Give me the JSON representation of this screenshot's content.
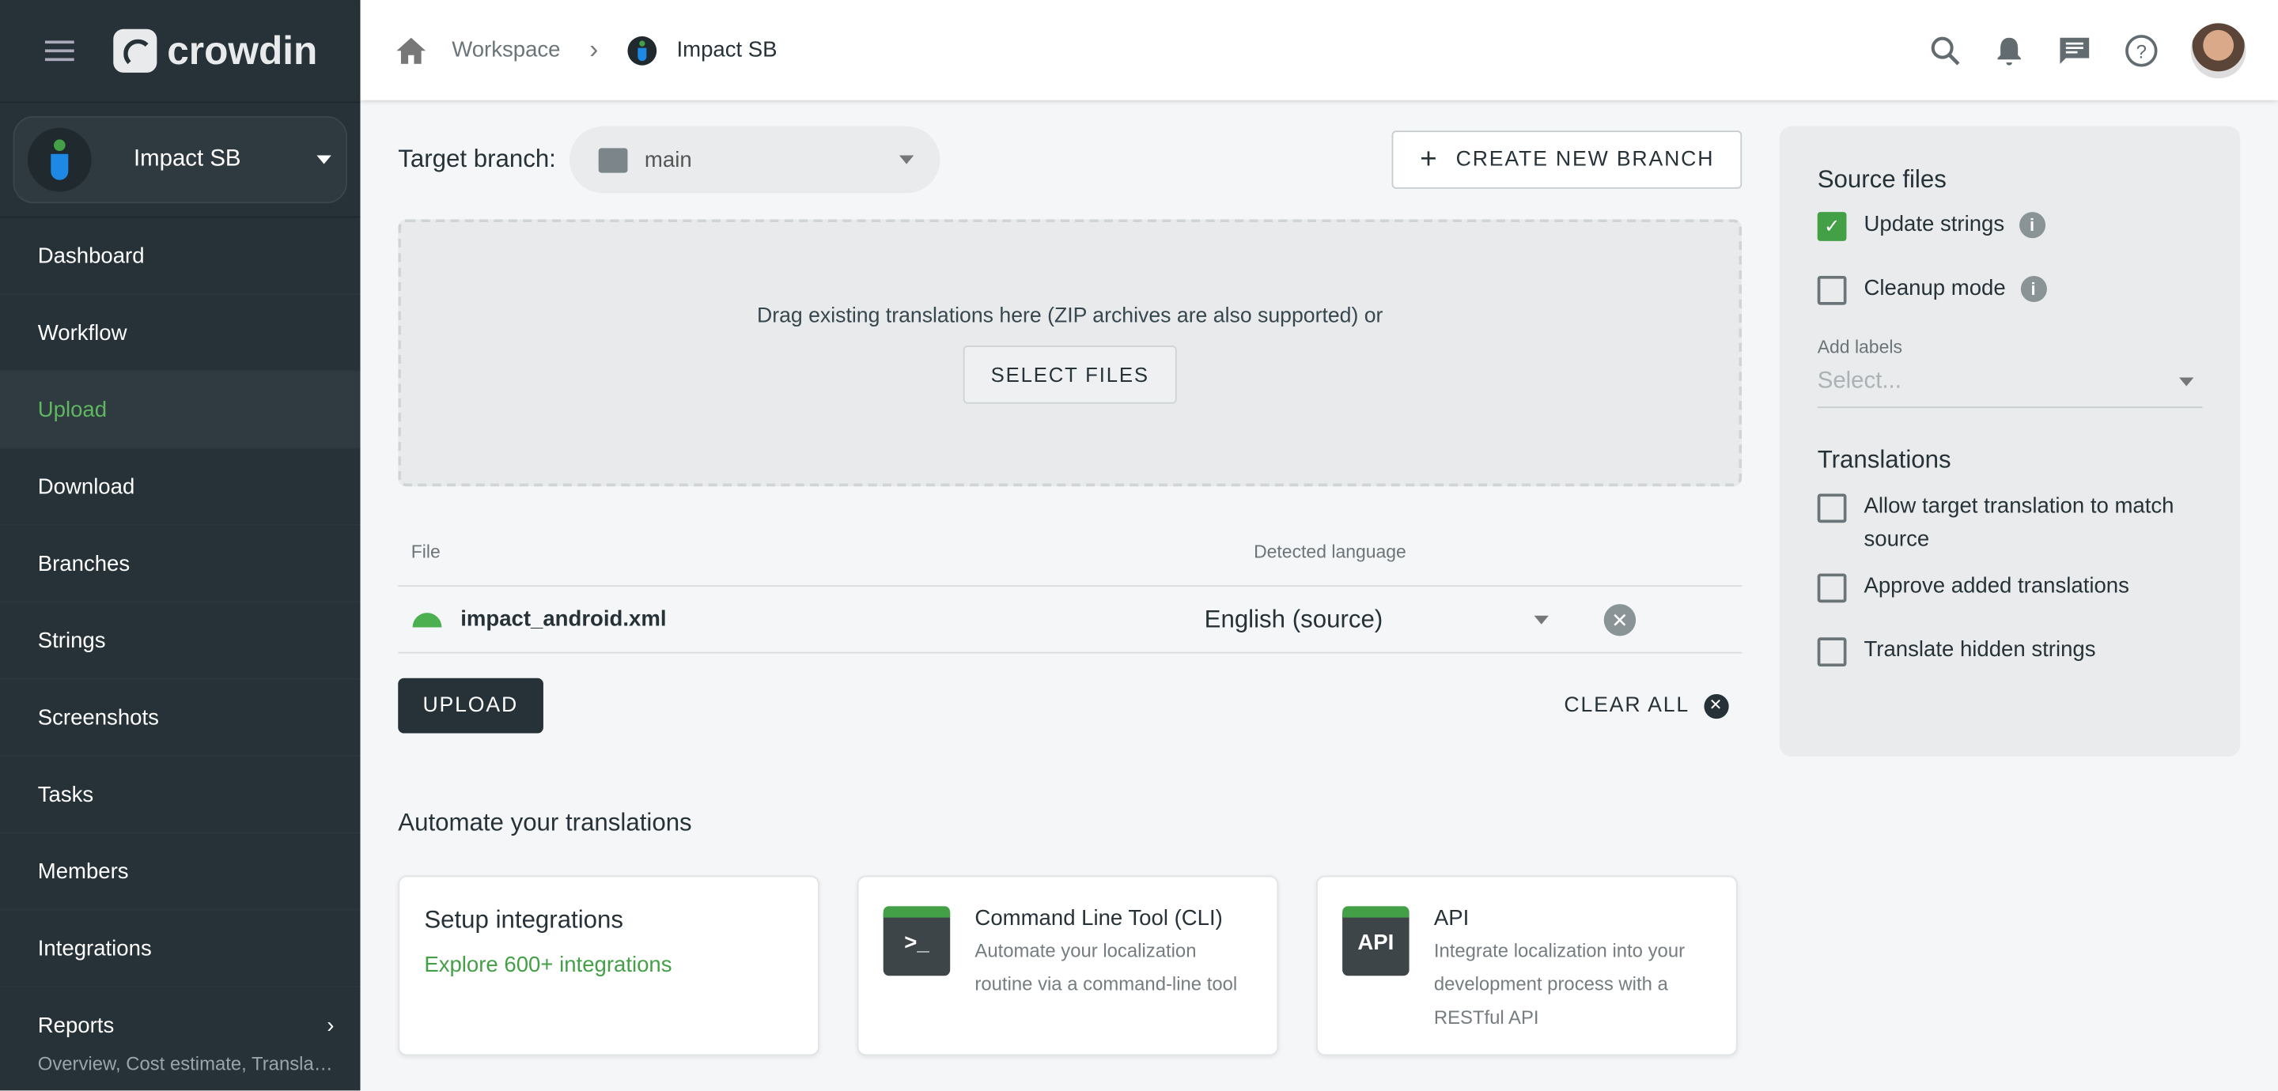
{
  "app": {
    "logo": "crowdin",
    "project": "Impact SB"
  },
  "sidebar": {
    "items": [
      {
        "label": "Dashboard"
      },
      {
        "label": "Workflow"
      },
      {
        "label": "Upload",
        "active": true
      },
      {
        "label": "Download"
      },
      {
        "label": "Branches"
      },
      {
        "label": "Strings"
      },
      {
        "label": "Screenshots"
      },
      {
        "label": "Tasks"
      },
      {
        "label": "Members"
      },
      {
        "label": "Integrations"
      }
    ],
    "reports": {
      "label": "Reports",
      "sub": "Overview, Cost estimate, Translation"
    }
  },
  "breadcrumb": {
    "workspace": "Workspace",
    "project": "Impact SB"
  },
  "main": {
    "target_label": "Target branch:",
    "branch": "main",
    "create_branch": "CREATE NEW BRANCH",
    "drop_text": "Drag existing translations here (ZIP archives are also supported) or",
    "select_files": "SELECT FILES",
    "table": {
      "col_file": "File",
      "col_lang": "Detected language",
      "rows": [
        {
          "file": "impact_android.xml",
          "language": "English (source)"
        }
      ]
    },
    "upload": "UPLOAD",
    "clear_all": "CLEAR ALL",
    "automate_title": "Automate your translations",
    "cards": [
      {
        "title": "Setup integrations",
        "link": "Explore 600+ integrations"
      },
      {
        "title": "Command Line Tool (CLI)",
        "icon": ">_",
        "desc": "Automate your localization routine via a command-line tool"
      },
      {
        "title": "API",
        "icon": "API",
        "desc": "Integrate localization into your development process with a RESTful API"
      }
    ]
  },
  "panel": {
    "source_title": "Source files",
    "update_strings": "Update strings",
    "cleanup_mode": "Cleanup mode",
    "add_labels": "Add labels",
    "labels_placeholder": "Select...",
    "translations_title": "Translations",
    "allow_match": "Allow target translation to match source",
    "approve_added": "Approve added translations",
    "translate_hidden": "Translate hidden strings"
  },
  "colors": {
    "sidebar": "#263238",
    "accent": "#43a047"
  }
}
